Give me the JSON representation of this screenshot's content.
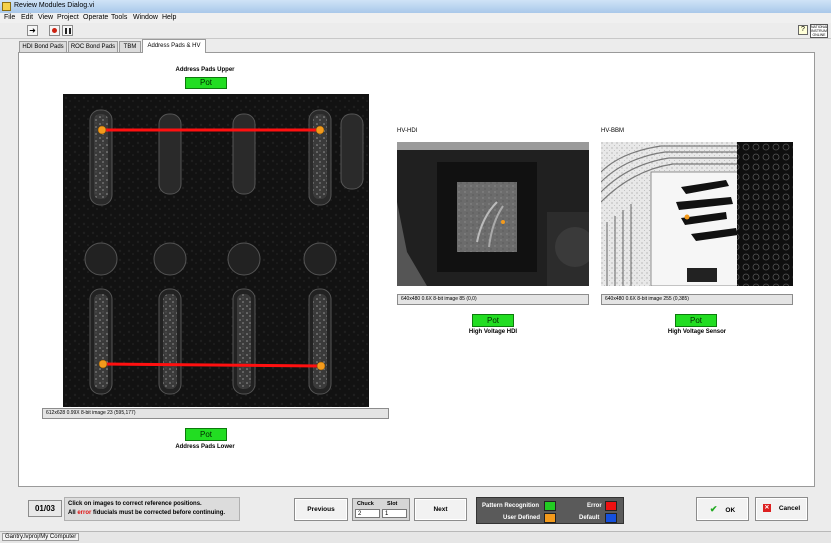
{
  "window": {
    "title": "Review Modules Dialog.vi"
  },
  "menu": [
    "File",
    "Edit",
    "View",
    "Project",
    "Operate",
    "Tools",
    "Window",
    "Help"
  ],
  "toolbar": {
    "run_icon": "run-arrow-icon",
    "stop_icon": "abort-icon",
    "pause_icon": "pause-icon",
    "help_label": "?"
  },
  "logo": {
    "lines": [
      "NATIONAL",
      "INSTRUMENTS",
      "ONLINE"
    ]
  },
  "tabs": [
    {
      "label": "HDI Bond Pads",
      "active": false
    },
    {
      "label": "ROC Bond Pads",
      "active": false
    },
    {
      "label": "TBM",
      "active": false
    },
    {
      "label": "Address Pads & HV",
      "active": true
    }
  ],
  "upper": {
    "title": "Address Pads Upper",
    "button": "Pot"
  },
  "main_image": {
    "status": "612x628 0.99X 8-bit image 23     (595,177)"
  },
  "lower": {
    "title": "Address Pads Lower",
    "button": "Pot"
  },
  "hv_hdi": {
    "label": "HV-HDI",
    "status": "640x480 0.6X 8-bit image 85     (0,0)",
    "button": "Pot",
    "caption": "High Voltage HDI"
  },
  "hv_bbm": {
    "label": "HV-BBM",
    "status": "640x480 0.6X 8-bit image 255     (0,385)",
    "button": "Pot",
    "caption": "High Voltage Sensor"
  },
  "bottom": {
    "counter": "01/03",
    "instruction1": "Click on images to correct reference positions.",
    "instruction2_pre": "All ",
    "instruction2_err": "error",
    "instruction2_post": " fiducials must be corrected before continuing.",
    "previous": "Previous",
    "chuck_label": "Chuck",
    "chuck_value": "2",
    "slot_label": "Slot",
    "slot_value": "1",
    "next": "Next",
    "ok": "OK",
    "cancel": "Cancel"
  },
  "legend": {
    "pattern": "Pattern Recognition",
    "user": "User Defined",
    "error": "Error",
    "default": "Default",
    "colors": {
      "pattern": "#22cc22",
      "user": "#f39a1c",
      "error": "#ee1111",
      "default": "#1550dd"
    }
  },
  "statusbar": {
    "path": "Gantry.lvproj/My Computer"
  }
}
